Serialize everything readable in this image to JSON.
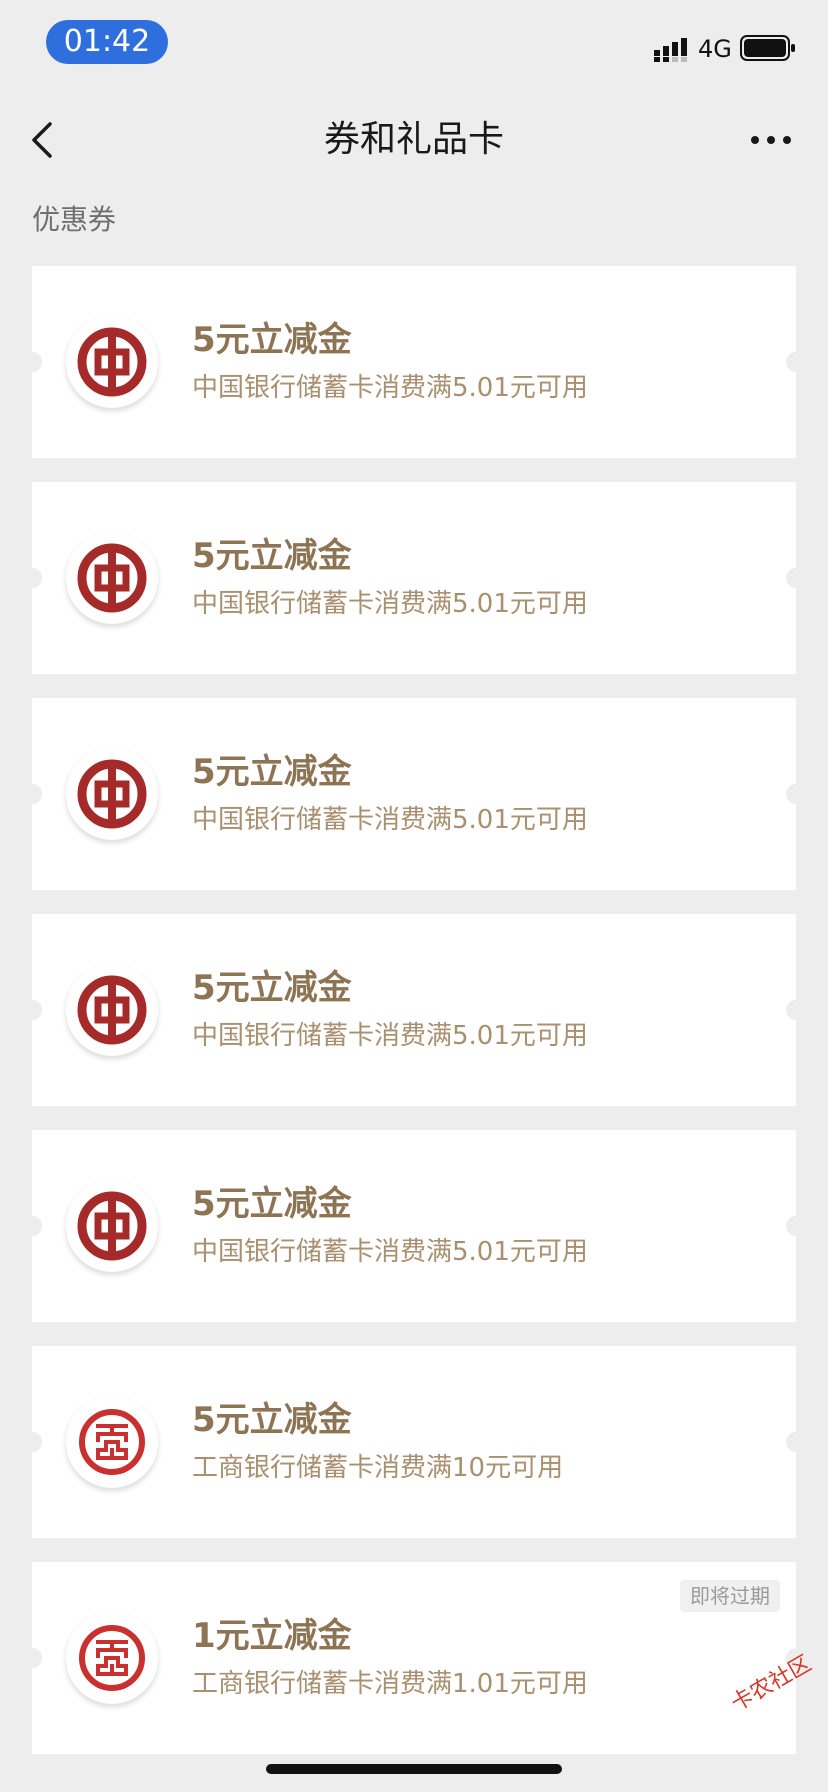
{
  "status_bar": {
    "time": "01:42",
    "network": "4G",
    "icons": {
      "signal": "signal-icon",
      "battery": "battery-icon"
    }
  },
  "nav": {
    "title": "券和礼品卡",
    "back_icon": "chevron-left-icon",
    "more_icon": "more-icon"
  },
  "section": {
    "label": "优惠券"
  },
  "coupons": [
    {
      "title": "5元立减金",
      "desc": "中国银行储蓄卡消费满5.01元可用",
      "bank_icon": "boc-logo-icon",
      "badge": ""
    },
    {
      "title": "5元立减金",
      "desc": "中国银行储蓄卡消费满5.01元可用",
      "bank_icon": "boc-logo-icon",
      "badge": ""
    },
    {
      "title": "5元立减金",
      "desc": "中国银行储蓄卡消费满5.01元可用",
      "bank_icon": "boc-logo-icon",
      "badge": ""
    },
    {
      "title": "5元立减金",
      "desc": "中国银行储蓄卡消费满5.01元可用",
      "bank_icon": "boc-logo-icon",
      "badge": ""
    },
    {
      "title": "5元立减金",
      "desc": "中国银行储蓄卡消费满5.01元可用",
      "bank_icon": "boc-logo-icon",
      "badge": ""
    },
    {
      "title": "5元立减金",
      "desc": "工商银行储蓄卡消费满10元可用",
      "bank_icon": "icbc-logo-icon",
      "badge": ""
    },
    {
      "title": "1元立减金",
      "desc": "工商银行储蓄卡消费满1.01元可用",
      "bank_icon": "icbc-logo-icon",
      "badge": "即将过期"
    }
  ],
  "watermark": {
    "text": "卡农社区"
  },
  "colors": {
    "time_pill": "#2f6fdd",
    "title": "#8c7454",
    "desc": "#a89070",
    "boc_red": "#a52a2a",
    "icbc_red": "#c8312f"
  }
}
